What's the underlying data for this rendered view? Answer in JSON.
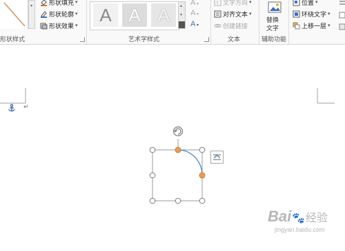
{
  "ribbon": {
    "shape_styles_group": {
      "label": "形状样式",
      "fill_label": "形状填充",
      "outline_label": "形状轮廓",
      "effects_label": "形状效果"
    },
    "wordart_group": {
      "label": "艺术字样式",
      "samples": [
        "A",
        "A",
        "A"
      ]
    },
    "text_group": {
      "label": "文本",
      "direction_label": "文字方向",
      "align_label": "对齐文本",
      "link_label": "创建链接"
    },
    "accessibility_group": {
      "label": "辅助功能",
      "alt_text_line1": "替换",
      "alt_text_line2": "文字"
    },
    "arrange_group": {
      "position_label": "位置",
      "wrap_label": "环绕文字",
      "bring_forward_label": "上移一层"
    }
  },
  "document": {
    "paragraph_mark": "↵"
  },
  "watermark": {
    "brand": "Bai",
    "paw": "🐾",
    "suffix": "经验",
    "url": "jingyan.baidu.com"
  },
  "colors": {
    "handle_fill": "#ffffff",
    "handle_stroke": "#7a7a7a",
    "adjust_handle": "#e8a050",
    "arc": "#4d86c4",
    "selection_border": "#9a9a9a"
  }
}
